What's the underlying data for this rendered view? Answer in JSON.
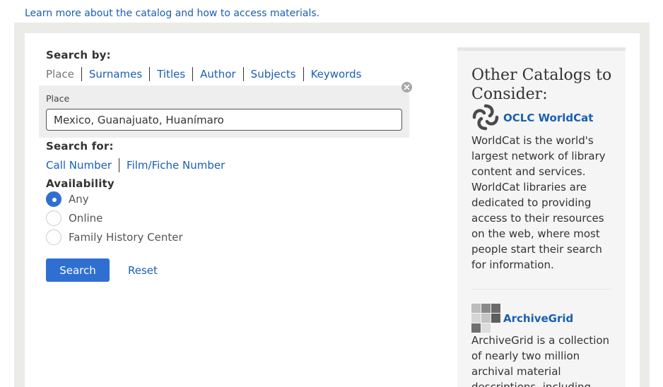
{
  "learn_more_link": "Learn more about the catalog and how to access materials.",
  "search_by": {
    "heading": "Search by:",
    "tabs": [
      {
        "label": "Place",
        "active": true
      },
      {
        "label": "Surnames",
        "active": false
      },
      {
        "label": "Titles",
        "active": false
      },
      {
        "label": "Author",
        "active": false
      },
      {
        "label": "Subjects",
        "active": false
      },
      {
        "label": "Keywords",
        "active": false
      }
    ],
    "field_label": "Place",
    "field_value": "Mexico, Guanajuato, Huanímaro"
  },
  "search_for": {
    "heading": "Search for:",
    "links": [
      "Call Number",
      "Film/Fiche Number"
    ]
  },
  "availability": {
    "heading": "Availability",
    "options": [
      {
        "label": "Any",
        "checked": true
      },
      {
        "label": "Online",
        "checked": false
      },
      {
        "label": "Family History Center",
        "checked": false
      }
    ]
  },
  "actions": {
    "search_label": "Search",
    "reset_label": "Reset"
  },
  "sidebar": {
    "heading": "Other Catalogs to Consider:",
    "catalogs": [
      {
        "name": "OCLC WorldCat",
        "icon": "worldcat-logo-icon",
        "description": "WorldCat is the world's largest network of library content and services. WorldCat libraries are dedicated to providing access to their resources on the web, where most people start their search for information."
      },
      {
        "name": "ArchiveGrid",
        "icon": "archivegrid-logo-icon",
        "description": "ArchiveGrid is a collection of nearly two million archival material descriptions, including"
      }
    ]
  },
  "colors": {
    "link": "#1a5fb4",
    "primary_button": "#2f6fd1",
    "page_frame": "#ebebe8",
    "sidebar_bg": "#f5f5f5",
    "place_box_bg": "#eeeeee"
  }
}
